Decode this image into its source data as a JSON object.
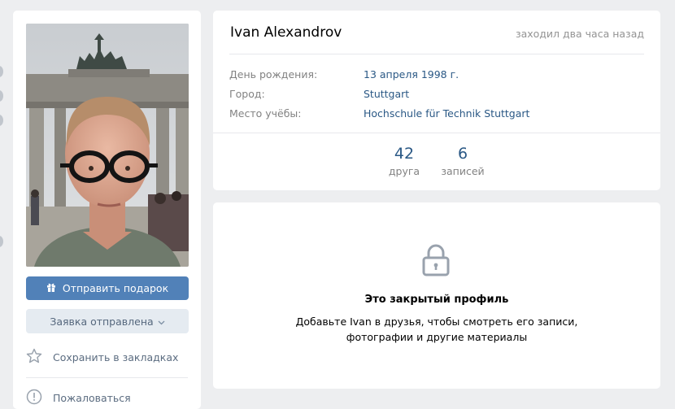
{
  "profile": {
    "name": "Ivan Alexandrov",
    "last_seen": "заходил два часа назад",
    "info": [
      {
        "label": "День рождения:",
        "value": "13 апреля 1998 г."
      },
      {
        "label": "Город:",
        "value": "Stuttgart"
      },
      {
        "label": "Место учёбы:",
        "value": "Hochschule für Technik Stuttgart"
      }
    ],
    "counters": [
      {
        "num": "42",
        "label": "друга"
      },
      {
        "num": "6",
        "label": "записей"
      }
    ]
  },
  "sidebar": {
    "gift_button": "Отправить подарок",
    "request_button": "Заявка отправлена",
    "bookmark_label": "Сохранить в закладках",
    "report_label": "Пожаловаться"
  },
  "closed_profile": {
    "title": "Это закрытый профиль",
    "text_line1": "Добавьте Ivan в друзья, чтобы смотреть его записи,",
    "text_line2": "фотографии и другие материалы"
  },
  "colors": {
    "accent": "#5181b8",
    "link": "#2a5885",
    "page_bg": "#edeef0"
  }
}
